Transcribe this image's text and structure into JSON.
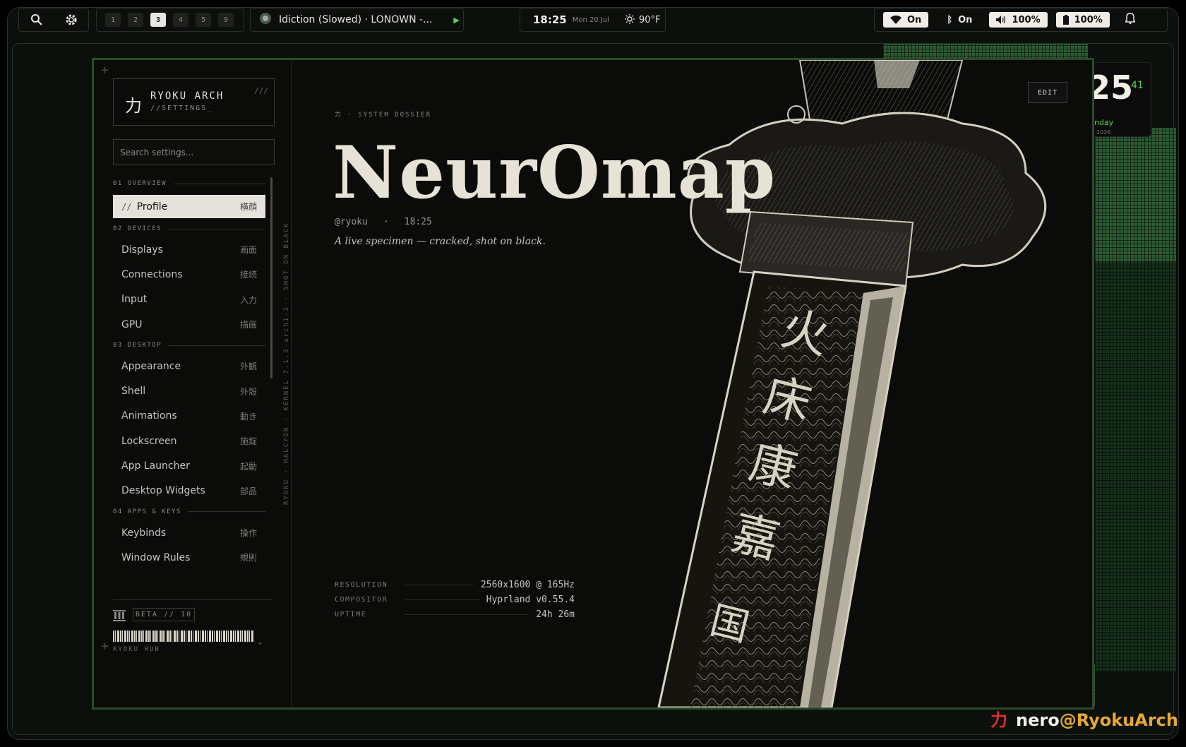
{
  "topbar": {
    "workspaces": [
      "1",
      "2",
      "3",
      "4",
      "5",
      "9"
    ],
    "active_workspace": "3",
    "media": {
      "title": "Idiction (Slowed) · LONOWN -..."
    },
    "clock": {
      "time": "18:25",
      "date": "Mon 20 Jul"
    },
    "weather": {
      "temp": "90°F"
    },
    "status": {
      "wifi": "On",
      "bluetooth": "On",
      "volume": "100%",
      "battery": "100%"
    }
  },
  "widget": {
    "big": "25",
    "small": "41",
    "day": "nday",
    "year": "2026"
  },
  "sidebar": {
    "brand_kanji": "力",
    "brand_title": "RYOKU ARCH",
    "brand_sub": "//SETTINGS_",
    "brand_mark": "///",
    "search_placeholder": "Search settings...",
    "sections": [
      {
        "label": "01 OVERVIEW",
        "items": [
          {
            "label": "Profile",
            "jp": "横顔",
            "active": true
          }
        ]
      },
      {
        "label": "02 DEVICES",
        "items": [
          {
            "label": "Displays",
            "jp": "画面"
          },
          {
            "label": "Connections",
            "jp": "接続"
          },
          {
            "label": "Input",
            "jp": "入力"
          },
          {
            "label": "GPU",
            "jp": "描画"
          }
        ]
      },
      {
        "label": "03 DESKTOP",
        "items": [
          {
            "label": "Appearance",
            "jp": "外観"
          },
          {
            "label": "Shell",
            "jp": "外殻"
          },
          {
            "label": "Animations",
            "jp": "動き"
          },
          {
            "label": "Lockscreen",
            "jp": "施錠"
          },
          {
            "label": "App Launcher",
            "jp": "起動"
          },
          {
            "label": "Desktop Widgets",
            "jp": "部品"
          }
        ]
      },
      {
        "label": "04 APPS & KEYS",
        "items": [
          {
            "label": "Keybinds",
            "jp": "操作"
          },
          {
            "label": "Window Rules",
            "jp": "規則"
          }
        ]
      }
    ],
    "beta": "BETA // 18",
    "hub": "RYOKU HUB",
    "vertical": "RYOKU · HALCYON · KERNEL 7.1.3-arch1-2 · SHOT ON BLACK"
  },
  "main": {
    "crumb": "力 · SYSTEM DOSSIER",
    "title": "NeurOmap",
    "handle": "@ryoku",
    "time": "18:25",
    "tagline": "A live specimen — cracked, shot on black.",
    "edit": "EDIT",
    "specs": [
      {
        "key": "RESOLUTION",
        "value": "2560x1600 @ 165Hz"
      },
      {
        "key": "COMPOSITOR",
        "value": "Hyprland v0.55.4"
      },
      {
        "key": "UPTIME",
        "value": "24h 26m"
      }
    ],
    "blade_glyphs": [
      "火",
      "床",
      "康",
      "嘉",
      "国"
    ]
  },
  "user": {
    "kanji": "力",
    "name": "nero",
    "host": "@RyokuArch"
  }
}
